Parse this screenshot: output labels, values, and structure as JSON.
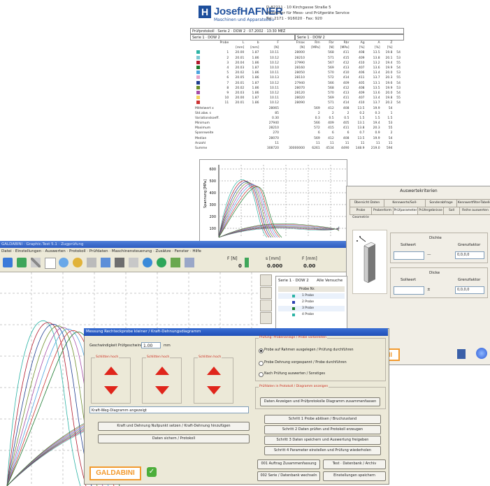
{
  "report": {
    "company": "JosefHAFNER",
    "company_sub": "Maschinen und Apparatebau",
    "address": "D-82211 · 10 Kirchgasse Straße 5\nHersteller für Mess- und Prüfgeräte Service\nTel: 2171 - 916020 · Fax: 920",
    "row1": "Prüfprotokoll · Serie 2 · DOW 2 · 07.2002 · 13:30 MEZ",
    "row2a": "Serie 1 · DOW 2",
    "row2b": "Serie 1 · DOW 2",
    "headers": [
      "",
      "Probe",
      "L",
      "b",
      "F",
      "Fmax",
      "Rm",
      "Fbr",
      "Rbr",
      "Ag",
      "A",
      "Z"
    ],
    "units": [
      "",
      "",
      "[mm]",
      "[mm]",
      "[N]",
      "[N]",
      "[MPa]",
      "[N]",
      "[MPa]",
      "[%]",
      "[%]",
      "[%]"
    ],
    "rows": [
      {
        "color": "#2bb3a5",
        "vals": [
          "1",
          "20.00",
          "1.87",
          "10.11",
          "28000",
          "",
          "568",
          "411",
          "408",
          "13.5",
          "19.8",
          "54"
        ]
      },
      {
        "color": "#7ec8d3",
        "vals": [
          "2",
          "20.01",
          "1.86",
          "10.12",
          "28210",
          "",
          "571",
          "415",
          "409",
          "13.8",
          "20.1",
          "53"
        ]
      },
      {
        "color": "#b2182b",
        "vals": [
          "3",
          "20.04",
          "1.86",
          "10.12",
          "27990",
          "",
          "567",
          "412",
          "410",
          "13.2",
          "19.4",
          "55"
        ]
      },
      {
        "color": "#1a7a2e",
        "vals": [
          "4",
          "20.03",
          "1.87",
          "10.10",
          "28160",
          "",
          "569",
          "413",
          "407",
          "13.6",
          "19.9",
          "54"
        ]
      },
      {
        "color": "#4aa3df",
        "vals": [
          "5",
          "20.02",
          "1.86",
          "10.11",
          "28050",
          "",
          "570",
          "410",
          "406",
          "13.4",
          "20.0",
          "53"
        ]
      },
      {
        "color": "#e6a1c8",
        "vals": [
          "6",
          "20.05",
          "1.86",
          "10.13",
          "28110",
          "",
          "572",
          "414",
          "411",
          "13.7",
          "20.3",
          "55"
        ]
      },
      {
        "color": "#1d3c8f",
        "vals": [
          "7",
          "20.01",
          "1.87",
          "10.12",
          "27940",
          "",
          "566",
          "409",
          "405",
          "13.1",
          "19.6",
          "54"
        ]
      },
      {
        "color": "#6d8e2a",
        "vals": [
          "8",
          "20.02",
          "1.86",
          "10.11",
          "28070",
          "",
          "568",
          "412",
          "408",
          "13.5",
          "19.9",
          "53"
        ]
      },
      {
        "color": "#a64ca6",
        "vals": [
          "9",
          "20.03",
          "1.86",
          "10.12",
          "28120",
          "",
          "570",
          "413",
          "409",
          "13.6",
          "20.0",
          "54"
        ]
      },
      {
        "color": "#f4d35e",
        "vals": [
          "10",
          "20.00",
          "1.87",
          "10.11",
          "28020",
          "",
          "569",
          "411",
          "407",
          "13.4",
          "19.8",
          "55"
        ]
      },
      {
        "color": "#cc3333",
        "vals": [
          "11",
          "20.01",
          "1.86",
          "10.12",
          "28090",
          "",
          "571",
          "414",
          "410",
          "13.7",
          "20.2",
          "54"
        ]
      }
    ],
    "stats": [
      {
        "label": "Mittelwert x",
        "vals": [
          "28065",
          "",
          "569",
          "412",
          "408",
          "13.5",
          "19.9",
          "54"
        ]
      },
      {
        "label": "Std.abw. s",
        "vals": [
          "85",
          "",
          "2",
          "2",
          "2",
          "0.2",
          "0.3",
          "1"
        ]
      },
      {
        "label": "Variationskoeff.",
        "vals": [
          "0.30",
          "",
          "0.3",
          "0.5",
          "0.5",
          "1.5",
          "1.5",
          "1.5"
        ]
      },
      {
        "label": "Minimum",
        "vals": [
          "27940",
          "",
          "566",
          "409",
          "405",
          "13.1",
          "19.4",
          "53"
        ]
      },
      {
        "label": "Maximum",
        "vals": [
          "28210",
          "",
          "572",
          "415",
          "411",
          "13.8",
          "20.3",
          "55"
        ]
      },
      {
        "label": "Spannweite",
        "vals": [
          "270",
          "",
          "6",
          "6",
          "6",
          "0.7",
          "0.9",
          "2"
        ]
      },
      {
        "label": "Median",
        "vals": [
          "28070",
          "",
          "569",
          "412",
          "408",
          "13.5",
          "19.9",
          "54"
        ]
      },
      {
        "label": "Anzahl",
        "vals": [
          "11",
          "",
          "11",
          "11",
          "11",
          "11",
          "11",
          "11"
        ]
      },
      {
        "label": "Summe",
        "vals": [
          "308720",
          "30000000",
          "6261",
          "4534",
          "4490",
          "148.9",
          "219.0",
          "594"
        ]
      }
    ]
  },
  "settings": {
    "title": "Auswertekriterien",
    "tabs_row1": [
      "Übersicht Daten",
      "Kennwerte/Soll-Grenzwerte",
      "Sonderabfrage",
      "Kennwertfilter-Tabelle"
    ],
    "tabs_row2": [
      "Probe Geometrie",
      "Probenform",
      "Prüfparameter",
      "Prüfergebnisse",
      "Soll",
      "Reihe auswerten"
    ],
    "group1": "Dichte",
    "group2": "Dicke",
    "sollwert": "Sollwert",
    "grenzfaktor": "Grenzfaktor",
    "select_value": "0,0,0,0"
  },
  "app": {
    "title": "GALDABINI · Graphic.Test 5.1 · Zugprüfung",
    "menu": "Datei · Einstellungen · Auswerten · Protokoll · Prüfdaten · Maschinensteuerung · Zusätze · Fenster · Hilfe",
    "readouts": [
      {
        "label": "F [N]",
        "value": "0"
      },
      {
        "label": "s [mm]",
        "value": "0.000"
      },
      {
        "label": "F [mm]",
        "value": "0.00"
      }
    ],
    "serie_label": "Serie 1 · DOW 2",
    "alle_label": "Alle Versuche",
    "probe_header": "Probe Nr.",
    "serie_items": [
      "1 Probe",
      "2 Probe",
      "3 Probe",
      "4 Probe"
    ]
  },
  "dialog": {
    "title": "Messung Rechteckprobe kleiner / Kraft-Dehnungsdiagramm",
    "speed_label": "Geschwindigkeit Prüfgeschwindigkeit",
    "speed_value": "1.00",
    "speed_unit": "mm",
    "arrows": [
      "Schlitten hoch",
      "Schlitten hoch",
      "Schlitten hoch"
    ],
    "status": "Kraft-Weg-Diagramm angezeigt",
    "btn_left1": "Kraft und Dehnung Nullpunkt setzen / Kraft-Dehnung hinzufügen",
    "btn_left2": "Daten sichern / Protokoll",
    "radio_group": "Prüfung: Probenanlage / Probe vorbereiten",
    "radios": [
      "Probe auf Rahmen ausgelegen / Prüfung durchführen",
      "Probe Dehnung vorgespannt / Probe durchführen",
      "Nach Prüfung auswerten / Sonstiges"
    ],
    "group2_title": "Prüfdaten in Protokoll / Diagramm anzeigen",
    "group2_btn": "Daten Anzeigen und Prüfprotokolle Diagramm zusammenfassen",
    "steps": [
      "Schritt 1 Probe ablösen / Bruchzustand",
      "Schritt 2 Daten prüfen und Protokoll erzeugen",
      "Schritt 3 Daten speichern und Auswertung freigeben",
      "Schritt 4 Parameter einstellen und Prüfung wiederholen"
    ],
    "bottom_btns": [
      "001 Auftrag Zusammenfassung",
      "Test · Datenbank / Archiv",
      "002 Serie / Datenbank wechseln",
      "Einstellungen speichern"
    ],
    "brand": "GALDABINI"
  },
  "axes": {
    "yunit": "Spannung [MPa]",
    "yticks": [
      "600",
      "500",
      "400",
      "300",
      "200",
      "100"
    ]
  }
}
